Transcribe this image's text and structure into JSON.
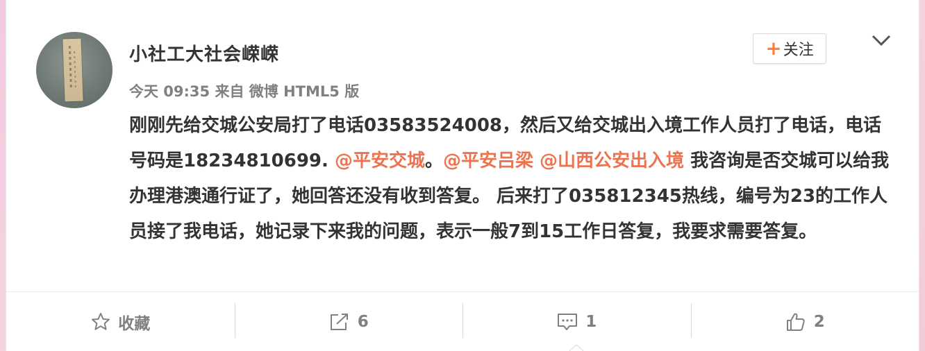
{
  "post": {
    "username": "小社工大社会嵘嵘",
    "meta": "今天 09:35 来自 微博 HTML5 版",
    "follow_label": "关注",
    "text_1": "刚刚先给交城公安局打了电话03583524008，然后又给交城出入境工作人员打了电话，电话号码是18234810699. ",
    "mention_1": "@平安交城",
    "text_2": "。",
    "mention_2": "@平安吕梁",
    "text_3": " ",
    "mention_3": "@山西公安出入境",
    "text_4": " 我咨询是否交城可以给我办理港澳通行证了，她回答还没有收到答复。 后来打了035812345热线，编号为23的工作人员接了我电话，她记录下来我的问题，表示一般7到15工作日答复，我要求需要答复。"
  },
  "actions": {
    "favorite_label": "收藏",
    "share_count": "6",
    "comment_count": "1",
    "like_count": "2"
  },
  "colors": {
    "mention": "#eb7350",
    "follow_plus": "#ff8140"
  },
  "icons": [
    "star-icon",
    "share-icon",
    "comment-icon",
    "thumbs-up-icon",
    "chevron-down-icon"
  ]
}
